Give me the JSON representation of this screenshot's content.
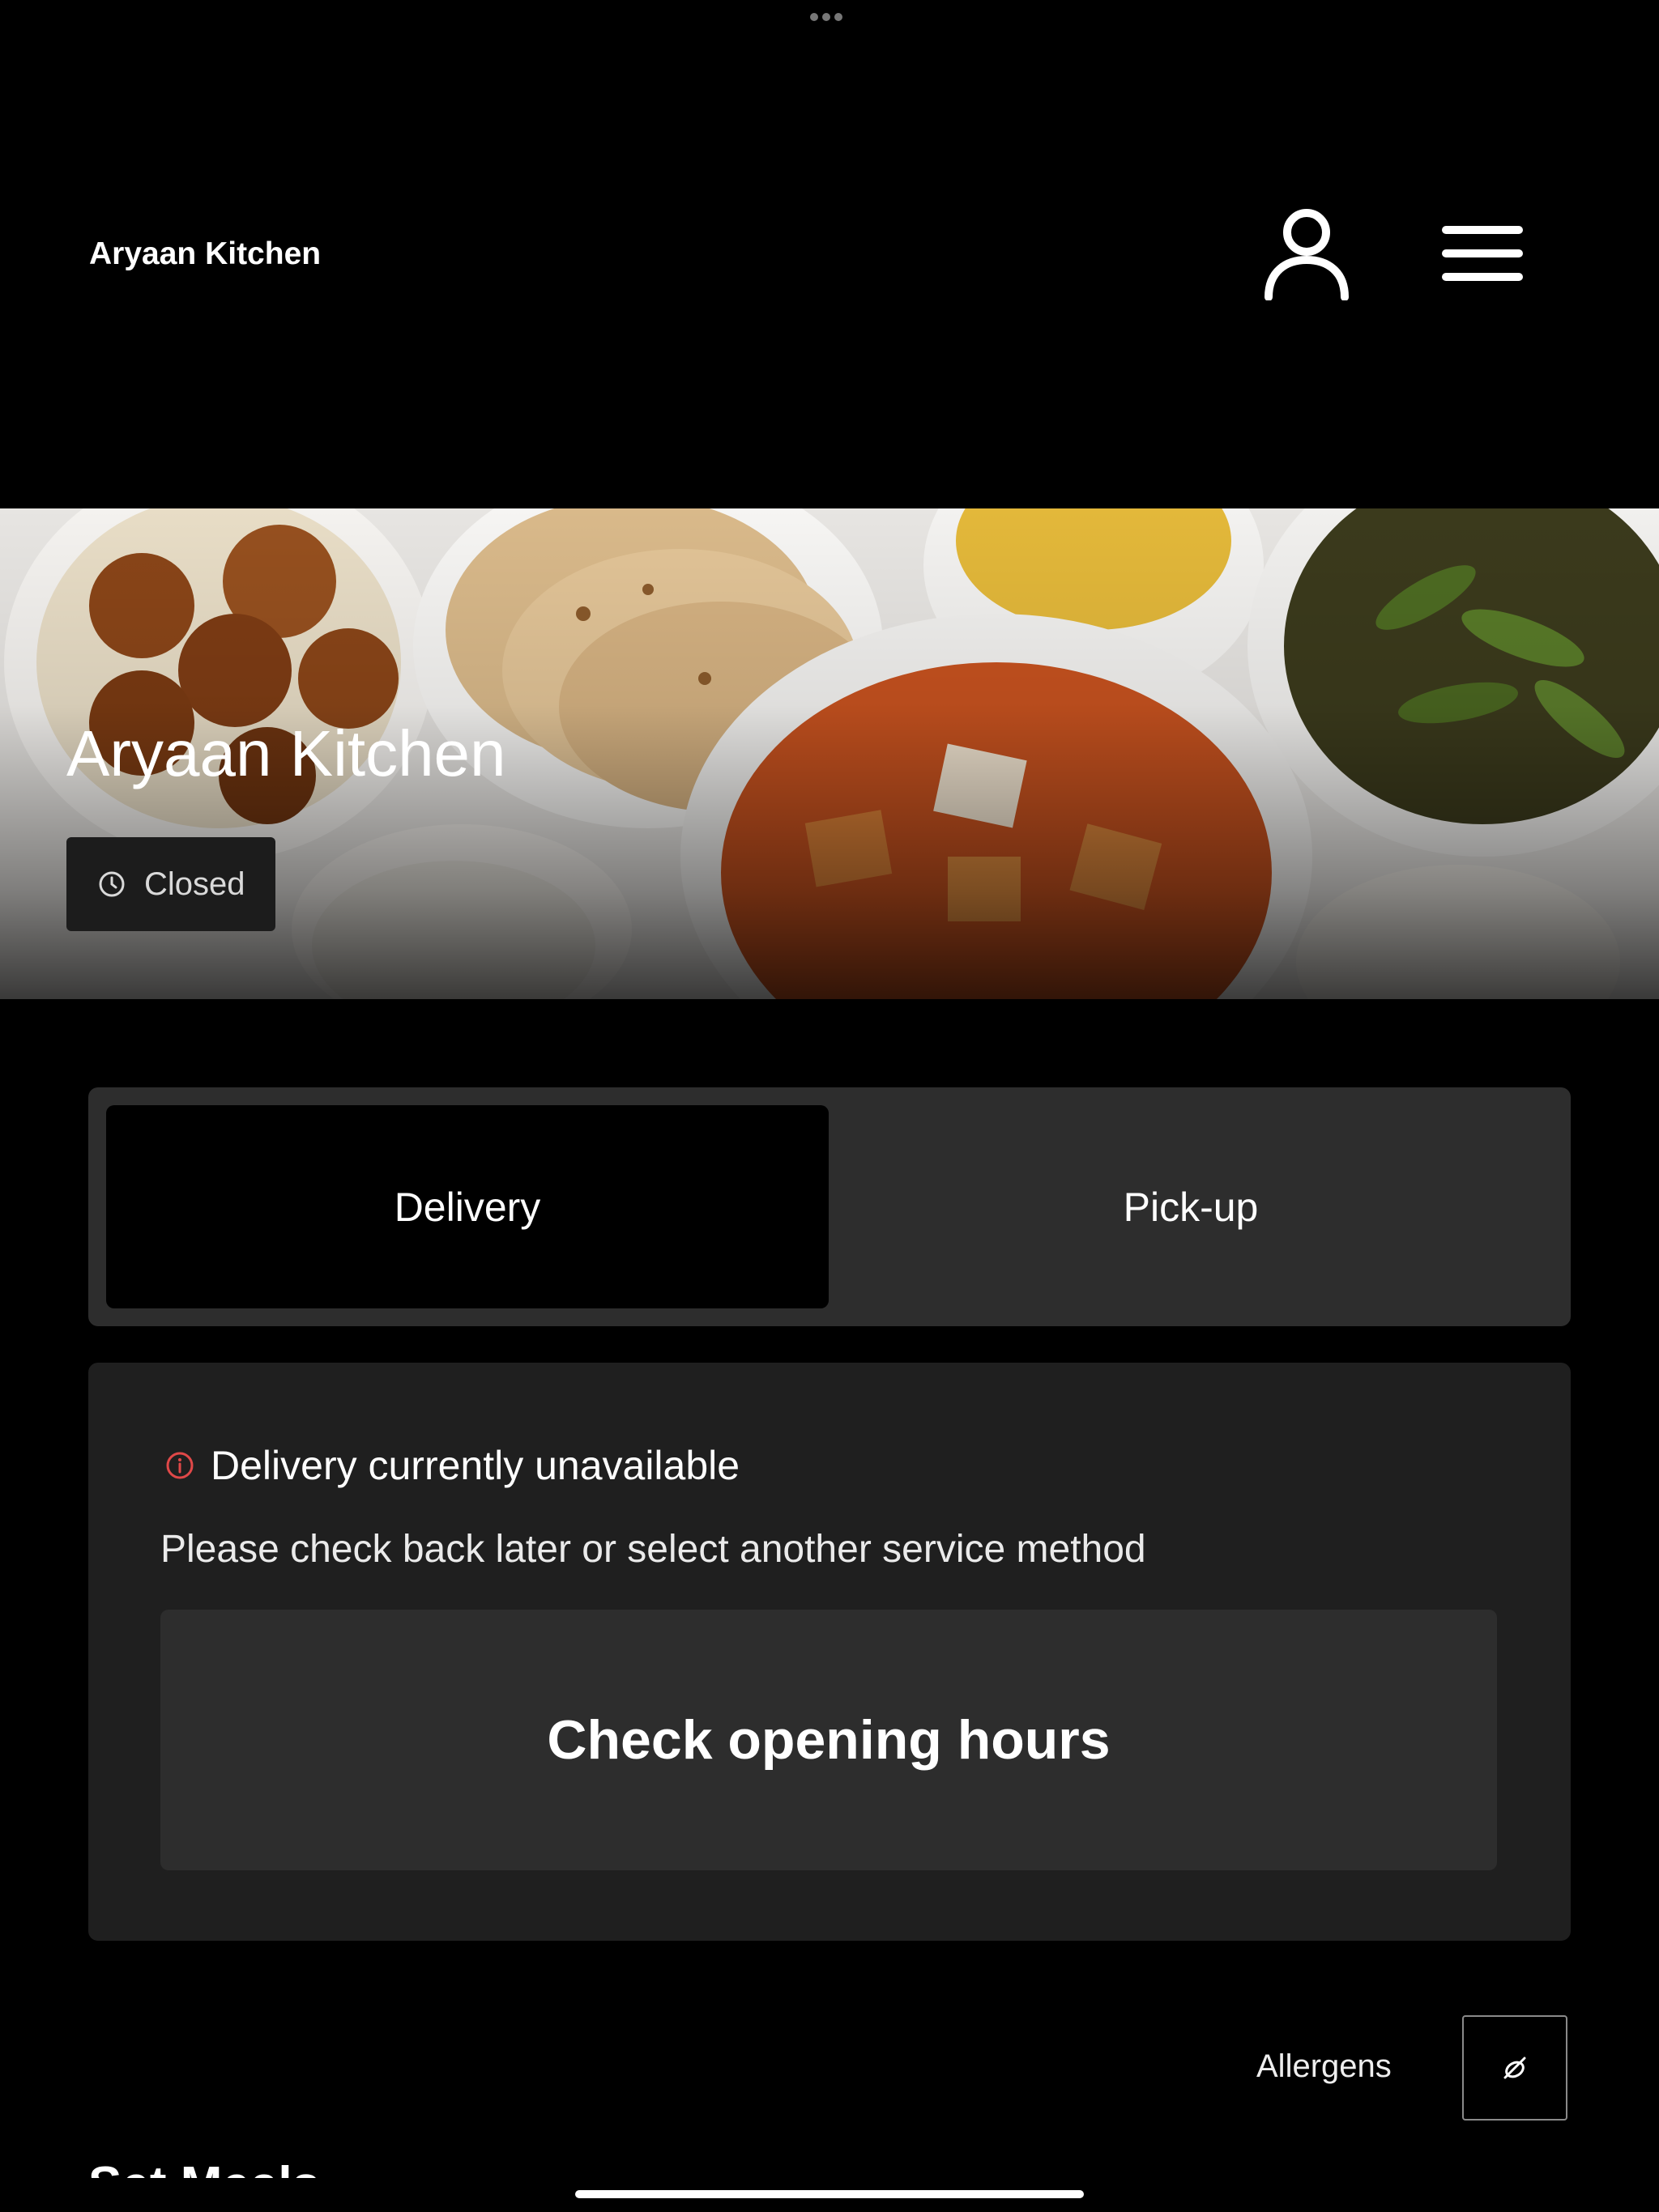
{
  "header": {
    "brand": "Aryaan Kitchen",
    "icons": {
      "account": "user-icon",
      "menu": "hamburger-menu-icon"
    }
  },
  "hero": {
    "title": "Aryaan Kitchen",
    "status": "Closed",
    "status_icon": "clock-icon"
  },
  "service": {
    "tabs": [
      {
        "label": "Delivery",
        "selected": true
      },
      {
        "label": "Pick-up",
        "selected": false
      }
    ]
  },
  "notice": {
    "icon": "info-icon",
    "icon_color": "#e04848",
    "title": "Delivery currently unavailable",
    "message": "Please check back later or select another service method",
    "button": "Check opening hours"
  },
  "allergens": {
    "label": "Allergens",
    "icon": "allergen-filter-icon"
  },
  "menu_section": {
    "title": "Set Meals"
  },
  "colors": {
    "background": "#000000",
    "panel": "#1f1f1f",
    "toggle_bg": "#2d2d2d",
    "accent_error": "#e04848"
  }
}
